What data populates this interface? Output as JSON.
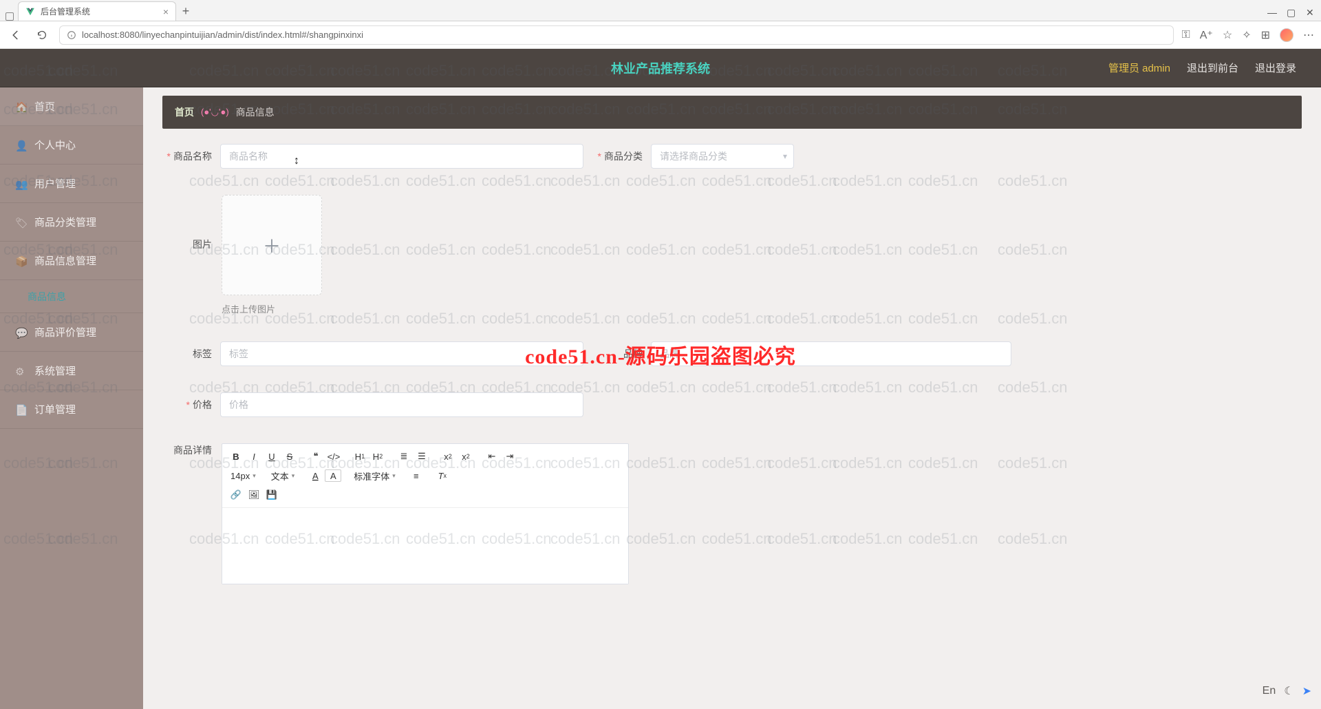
{
  "browser": {
    "tab_title": "后台管理系统",
    "url": "localhost:8080/linyechanpintuijian/admin/dist/index.html#/shangpinxinxi"
  },
  "header": {
    "title": "林业产品推荐系统",
    "user_label": "管理员 admin",
    "link_exit_front": "退出到前台",
    "link_logout": "退出登录"
  },
  "sidebar": {
    "items": [
      {
        "label": "首页"
      },
      {
        "label": "个人中心"
      },
      {
        "label": "用户管理"
      },
      {
        "label": "商品分类管理"
      },
      {
        "label": "商品信息管理"
      },
      {
        "label": "商品信息",
        "sub": true
      },
      {
        "label": "商品评价管理"
      },
      {
        "label": "系统管理"
      },
      {
        "label": "订单管理"
      }
    ]
  },
  "breadcrumb": {
    "home": "首页",
    "emoji": "(●'◡'●)",
    "current": "商品信息"
  },
  "form": {
    "name_label": "商品名称",
    "name_placeholder": "商品名称",
    "category_label": "商品分类",
    "category_placeholder": "请选择商品分类",
    "image_label": "图片",
    "image_hint": "点击上传图片",
    "tag_label": "标签",
    "tag_placeholder": "标签",
    "brand_label": "品牌",
    "brand_placeholder": "品牌",
    "price_label": "价格",
    "price_placeholder": "价格",
    "detail_label": "商品详情"
  },
  "editor_toolbar": {
    "font_size": "14px",
    "font_body": "文本",
    "font_family": "标准字体"
  },
  "watermark": {
    "repeat_text": "code51.cn",
    "center_text": "code51.cn-源码乐园盗图必究"
  }
}
